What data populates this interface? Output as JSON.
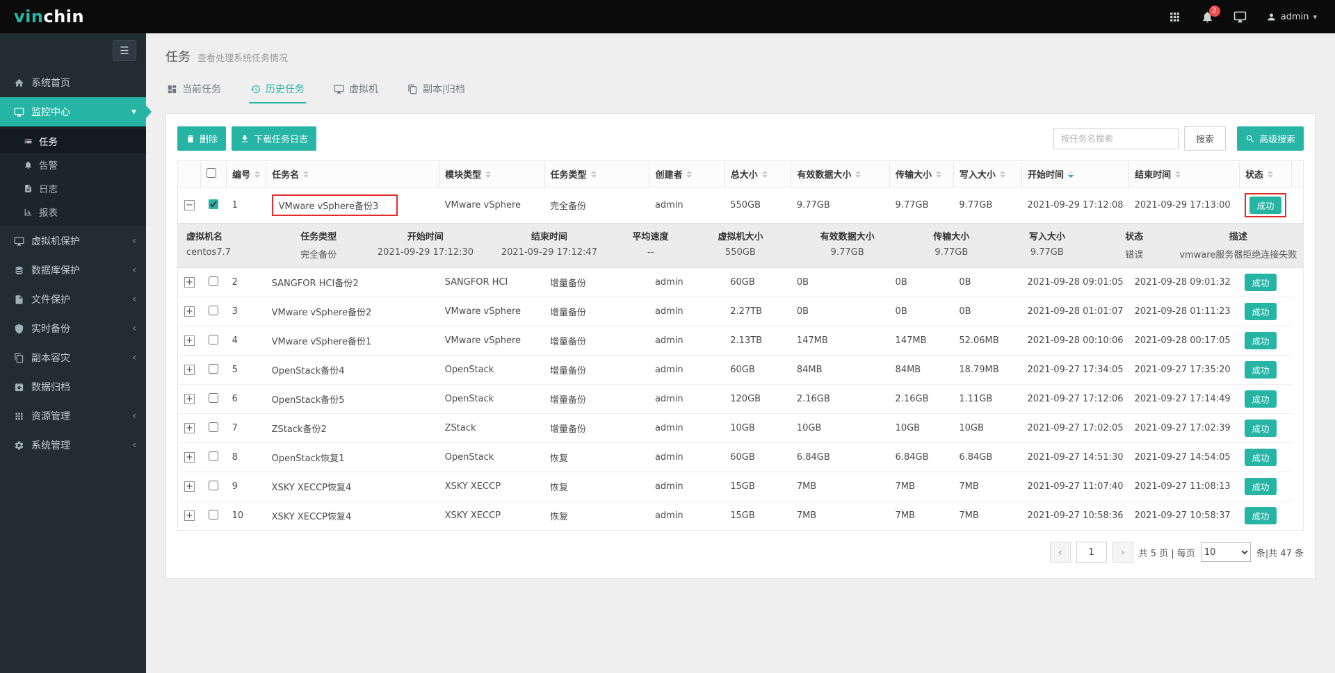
{
  "colors": {
    "accent": "#26b4a4",
    "annotation": "#e12b2b",
    "notification": "#f05050"
  },
  "topbar": {
    "logo_part1": "vin",
    "logo_part2": "chin",
    "notification_count": "2",
    "user_label": "admin"
  },
  "sidebar": {
    "menu": [
      {
        "key": "home",
        "icon": "home-icon",
        "label": "系统首页"
      },
      {
        "key": "monitor-center",
        "icon": "monitor-icon",
        "label": "监控中心",
        "active": true,
        "expanded": true,
        "children": [
          {
            "label": "任务",
            "icon": "tasks-icon",
            "selected": true
          },
          {
            "label": "告警",
            "icon": "bell-icon"
          },
          {
            "label": "日志",
            "icon": "log-icon"
          },
          {
            "label": "报表",
            "icon": "report-icon"
          }
        ]
      },
      {
        "key": "vm-protection",
        "icon": "vm-icon",
        "label": "虚拟机保护",
        "collapsible": true
      },
      {
        "key": "db-protection",
        "icon": "database-icon",
        "label": "数据库保护",
        "collapsible": true
      },
      {
        "key": "file-protection",
        "icon": "file-icon",
        "label": "文件保护",
        "collapsible": true
      },
      {
        "key": "realtime-backup",
        "icon": "shield-icon",
        "label": "实时备份",
        "collapsible": true
      },
      {
        "key": "replica-dr",
        "icon": "copy-icon",
        "label": "副本容灾",
        "collapsible": true
      },
      {
        "key": "data-archive",
        "icon": "archive-icon",
        "label": "数据归档"
      },
      {
        "key": "resource-mgmt",
        "icon": "apps-icon",
        "label": "资源管理",
        "collapsible": true
      },
      {
        "key": "system-mgmt",
        "icon": "gear-icon",
        "label": "系统管理",
        "collapsible": true
      }
    ]
  },
  "header": {
    "title": "任务",
    "subtitle": "查看处理系统任务情况"
  },
  "tabs": [
    {
      "label": "当前任务",
      "icon": "gauge-icon"
    },
    {
      "label": "历史任务",
      "icon": "history-icon",
      "active": true
    },
    {
      "label": "虚拟机",
      "icon": "vm-icon"
    },
    {
      "label": "副本|归档",
      "icon": "copy-icon"
    }
  ],
  "toolbar": {
    "delete_label": "删除",
    "download_label": "下载任务日志",
    "search_placeholder": "按任务名搜索",
    "search_label": "搜索",
    "advanced_label": "高级搜索"
  },
  "table": {
    "columns": [
      "编号",
      "任务名",
      "模块类型",
      "任务类型",
      "创建者",
      "总大小",
      "有效数据大小",
      "传输大小",
      "写入大小",
      "开始时间",
      "结束时间",
      "状态"
    ],
    "sorted_column": "开始时间",
    "rows": [
      {
        "no": "1",
        "name": "VMware vSphere备份3",
        "module": "VMware vSphere",
        "type": "完全备份",
        "creator": "admin",
        "total": "550GB",
        "valid": "9.77GB",
        "transfer": "9.77GB",
        "written": "9.77GB",
        "start": "2021-09-29 17:12:08",
        "end": "2021-09-29 17:13:00",
        "status": "成功",
        "checked": true,
        "expanded": true,
        "highlight_name": true,
        "highlight_status": true
      },
      {
        "no": "2",
        "name": "SANGFOR HCI备份2",
        "module": "SANGFOR HCI",
        "type": "增量备份",
        "creator": "admin",
        "total": "60GB",
        "valid": "0B",
        "transfer": "0B",
        "written": "0B",
        "start": "2021-09-28 09:01:05",
        "end": "2021-09-28 09:01:32",
        "status": "成功"
      },
      {
        "no": "3",
        "name": "VMware vSphere备份2",
        "module": "VMware vSphere",
        "type": "增量备份",
        "creator": "admin",
        "total": "2.27TB",
        "valid": "0B",
        "transfer": "0B",
        "written": "0B",
        "start": "2021-09-28 01:01:07",
        "end": "2021-09-28 01:11:23",
        "status": "成功"
      },
      {
        "no": "4",
        "name": "VMware vSphere备份1",
        "module": "VMware vSphere",
        "type": "增量备份",
        "creator": "admin",
        "total": "2.13TB",
        "valid": "147MB",
        "transfer": "147MB",
        "written": "52.06MB",
        "start": "2021-09-28 00:10:06",
        "end": "2021-09-28 00:17:05",
        "status": "成功"
      },
      {
        "no": "5",
        "name": "OpenStack备份4",
        "module": "OpenStack",
        "type": "增量备份",
        "creator": "admin",
        "total": "60GB",
        "valid": "84MB",
        "transfer": "84MB",
        "written": "18.79MB",
        "start": "2021-09-27 17:34:05",
        "end": "2021-09-27 17:35:20",
        "status": "成功"
      },
      {
        "no": "6",
        "name": "OpenStack备份5",
        "module": "OpenStack",
        "type": "增量备份",
        "creator": "admin",
        "total": "120GB",
        "valid": "2.16GB",
        "transfer": "2.16GB",
        "written": "1.11GB",
        "start": "2021-09-27 17:12:06",
        "end": "2021-09-27 17:14:49",
        "status": "成功"
      },
      {
        "no": "7",
        "name": "ZStack备份2",
        "module": "ZStack",
        "type": "增量备份",
        "creator": "admin",
        "total": "10GB",
        "valid": "10GB",
        "transfer": "10GB",
        "written": "10GB",
        "start": "2021-09-27 17:02:05",
        "end": "2021-09-27 17:02:39",
        "status": "成功"
      },
      {
        "no": "8",
        "name": "OpenStack恢复1",
        "module": "OpenStack",
        "type": "恢复",
        "creator": "admin",
        "total": "60GB",
        "valid": "6.84GB",
        "transfer": "6.84GB",
        "written": "6.84GB",
        "start": "2021-09-27 14:51:30",
        "end": "2021-09-27 14:54:05",
        "status": "成功"
      },
      {
        "no": "9",
        "name": "XSKY XECCP恢复4",
        "module": "XSKY XECCP",
        "type": "恢复",
        "creator": "admin",
        "total": "15GB",
        "valid": "7MB",
        "transfer": "7MB",
        "written": "7MB",
        "start": "2021-09-27 11:07:40",
        "end": "2021-09-27 11:08:13",
        "status": "成功"
      },
      {
        "no": "10",
        "name": "XSKY XECCP恢复4",
        "module": "XSKY XECCP",
        "type": "恢复",
        "creator": "admin",
        "total": "15GB",
        "valid": "7MB",
        "transfer": "7MB",
        "written": "7MB",
        "start": "2021-09-27 10:58:36",
        "end": "2021-09-27 10:58:37",
        "status": "成功"
      }
    ],
    "expanded_detail": {
      "columns": [
        "虚拟机名",
        "任务类型",
        "开始时间",
        "结束时间",
        "平均速度",
        "虚拟机大小",
        "有效数据大小",
        "传输大小",
        "写入大小",
        "状态",
        "描述"
      ],
      "values": [
        "centos7.7",
        "完全备份",
        "2021-09-29 17:12:30",
        "2021-09-29 17:12:47",
        "--",
        "550GB",
        "9.77GB",
        "9.77GB",
        "9.77GB",
        "错误",
        "vmware服务器拒绝连接失败"
      ]
    }
  },
  "pagination": {
    "prev": "‹",
    "page": "1",
    "next": "›",
    "pages_text": "共 5 页 | 每页",
    "per_page": "10",
    "total_text": "条|共 47 条"
  }
}
